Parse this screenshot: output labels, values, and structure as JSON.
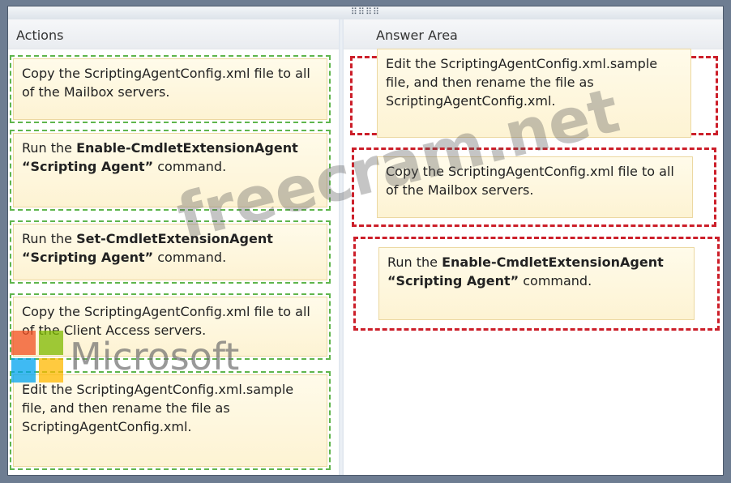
{
  "actions": {
    "title": "Actions",
    "items": [
      {
        "parts": [
          {
            "t": "Copy the ScriptingAgentConfig.xml file to all of the Mailbox servers.",
            "b": false
          }
        ]
      },
      {
        "parts": [
          {
            "t": "Run the ",
            "b": false
          },
          {
            "t": "Enable-CmdletExtensionAgent “Scripting Agent”",
            "b": true
          },
          {
            "t": " command.",
            "b": false
          }
        ]
      },
      {
        "parts": [
          {
            "t": "Run the ",
            "b": false
          },
          {
            "t": "Set-CmdletExtensionAgent “Scripting Agent”",
            "b": true
          },
          {
            "t": " command.",
            "b": false
          }
        ]
      },
      {
        "parts": [
          {
            "t": "Copy the ScriptingAgentConfig.xml file to all of the Client Access servers.",
            "b": false
          }
        ]
      },
      {
        "parts": [
          {
            "t": "Edit the ScriptingAgentConfig.xml.sample file, and then rename the file as ScriptingAgentConfig.xml.",
            "b": false
          }
        ]
      }
    ]
  },
  "answer": {
    "title": "Answer Area",
    "items": [
      {
        "parts": [
          {
            "t": "Edit the ScriptingAgentConfig.xml.sample file, and then rename the file as ScriptingAgentConfig.xml.",
            "b": false
          }
        ]
      },
      {
        "parts": [
          {
            "t": "Copy the ScriptingAgentConfig.xml file to all of the Mailbox servers.",
            "b": false
          }
        ]
      },
      {
        "parts": [
          {
            "t": "Run the ",
            "b": false
          },
          {
            "t": "Enable-CmdletExtensionAgent “Scripting Agent”",
            "b": true
          },
          {
            "t": " command.",
            "b": false
          }
        ]
      }
    ]
  },
  "grip_glyph": "⠿⠿⠿⠿",
  "watermark": "freecram.net",
  "logo_text": "Microsoft",
  "colors": {
    "slot_green": "#5fb54d",
    "slot_red": "#cc1f2a",
    "tile_bg": "#fdf3d3",
    "logo": [
      "#f25022",
      "#7fba00",
      "#00a4ef",
      "#ffb900"
    ]
  }
}
